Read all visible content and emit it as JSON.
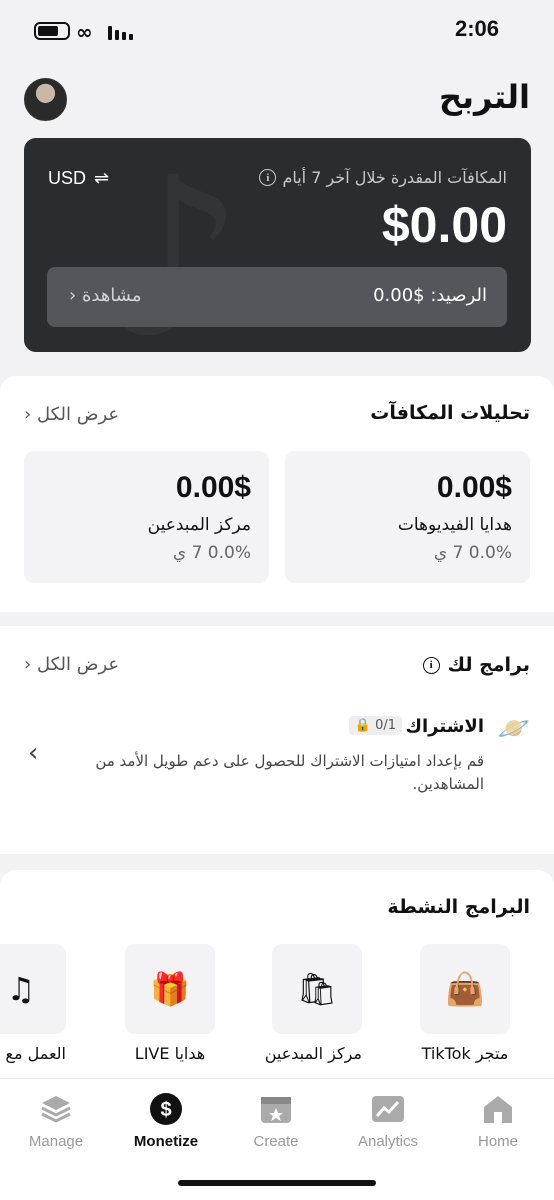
{
  "status_bar": {
    "time": "2:06"
  },
  "header": {
    "title": "التربح"
  },
  "earnings": {
    "label": "المكافآت المقدرة خلال آخر 7 أيام",
    "currency": "USD",
    "amount": "$0.00",
    "balance": "الرصيد: $0.00",
    "view": "مشاهدة"
  },
  "analytics": {
    "title": "تحليلات المكافآت",
    "see_all": "عرض الكل",
    "tiles": [
      {
        "value": "0.00$",
        "name": "هدايا الفيديوهات",
        "change": "0.0% 7 ي"
      },
      {
        "value": "0.00$",
        "name": "مركز المبدعين",
        "change": "0.0% 7 ي"
      }
    ]
  },
  "programs": {
    "title": "برامج لك",
    "see_all": "عرض الكل",
    "subscription": {
      "title": "الاشتراك",
      "badge": "0/1",
      "description": "قم بإعداد امتيازات الاشتراك للحصول على دعم طويل الأمد من المشاهدين."
    }
  },
  "active_programs": {
    "title": "البرامج النشطة",
    "items": [
      {
        "label": "متجر TikTok",
        "icon": "shopping-bag-icon"
      },
      {
        "label": "مركز المبدعين",
        "icon": "star-bag-icon"
      },
      {
        "label": "هدايا LIVE",
        "icon": "gift-icon"
      },
      {
        "label": "العمل مع الف",
        "icon": "music-note-icon"
      }
    ]
  },
  "bottom_nav": {
    "items": [
      {
        "label": "Manage",
        "icon": "layers-icon"
      },
      {
        "label": "Monetize",
        "icon": "dollar-icon"
      },
      {
        "label": "Create",
        "icon": "clapper-icon"
      },
      {
        "label": "Analytics",
        "icon": "chart-icon"
      },
      {
        "label": "Home",
        "icon": "home-icon"
      }
    ],
    "active": "Monetize"
  }
}
